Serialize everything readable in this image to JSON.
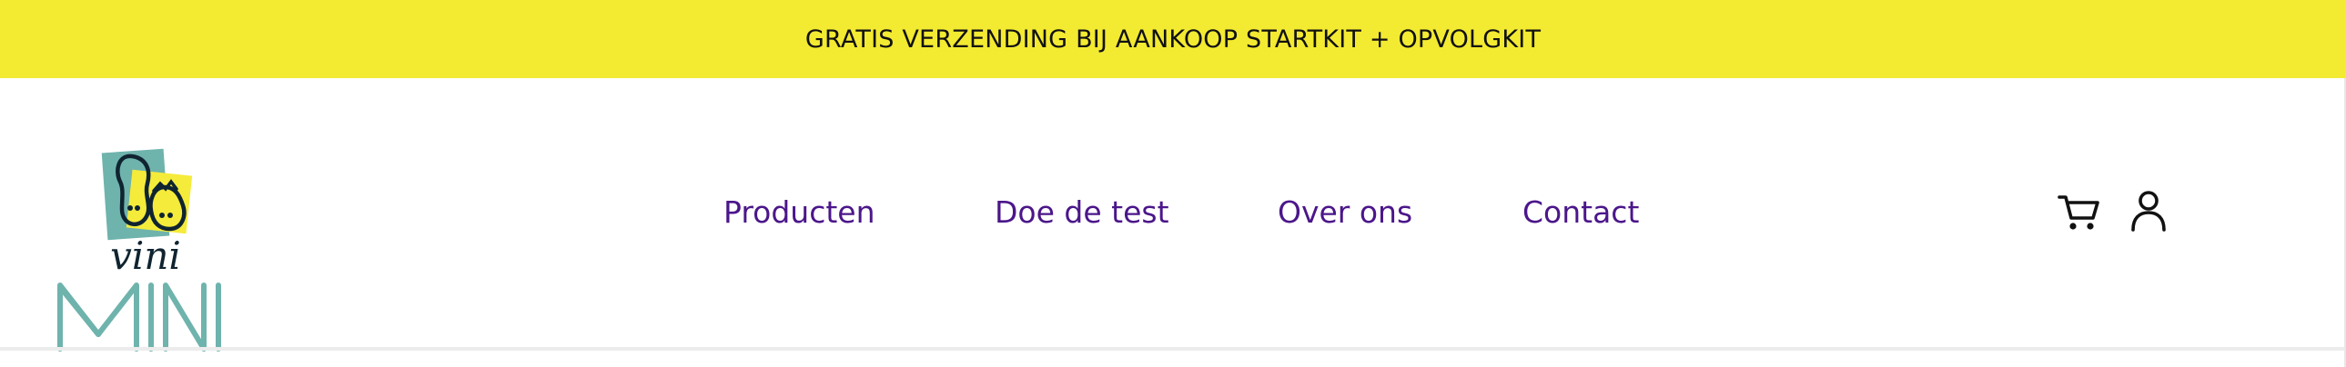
{
  "colors": {
    "banner_background": "#f3ea32",
    "nav_text": "#4b168a",
    "logo_teal": "#6fb3ad",
    "logo_yellow": "#f5eb3a",
    "icon_color": "#111111"
  },
  "announcement": {
    "text": "GRATIS VERZENDING BIJ AANKOOP STARTKIT + OPVOLGKIT"
  },
  "logo": {
    "script_text": "vini",
    "wordmark": "MINI"
  },
  "nav": {
    "items": [
      {
        "label": "Producten"
      },
      {
        "label": "Doe de test"
      },
      {
        "label": "Over ons"
      },
      {
        "label": "Contact"
      }
    ]
  },
  "icons": {
    "cart": "cart-icon",
    "account": "user-icon"
  }
}
